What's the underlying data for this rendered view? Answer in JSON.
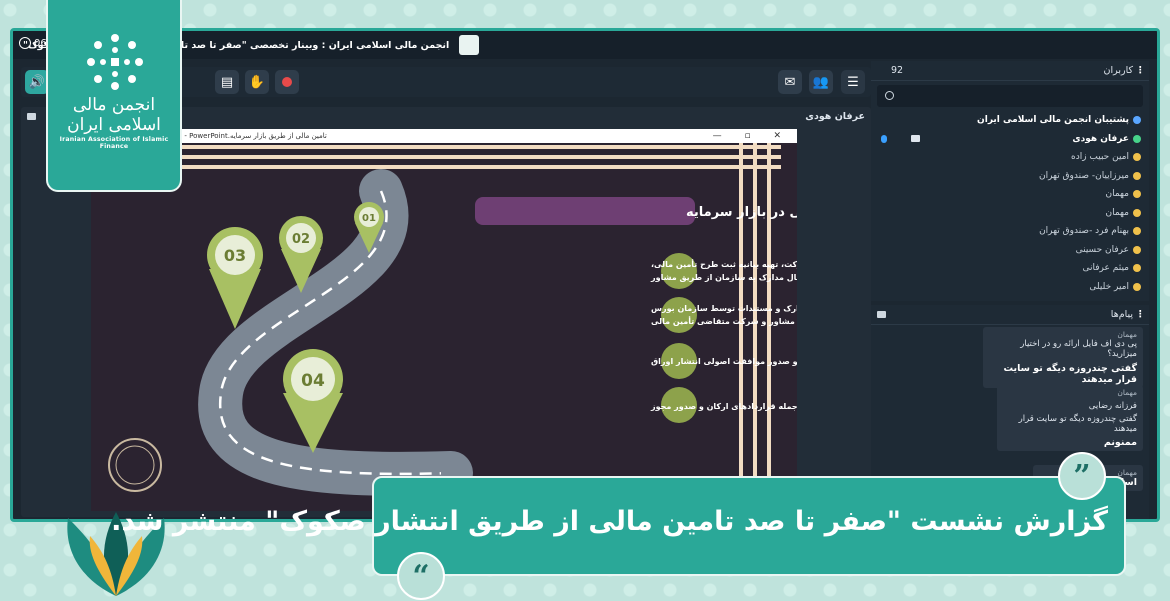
{
  "window": {
    "title": "انجمن مالی اسلامی ایران : وبینار تخصصی \"صفر تا صد تامین مالی از طریق انتشار صکوک\"",
    "clock": "06"
  },
  "stage": {
    "presenter": "عرفان هودی",
    "ppt_title": "ppt [Compatibility Mode] - PowerPoint.تامین مالی از طریق بازار سرمایه",
    "ppt_controls": "—  ▫  ✕"
  },
  "slide": {
    "heading": "مسیر تأمین مالی در بازار سرمایه",
    "steps": [
      {
        "num": "01",
        "lines": [
          "بررسی طرح توسط شرکت، تهیه بیانیه ثبت طرح تأمین مالی،",
          "دریافت نظر حسابرس و ارسال مدارک به سازمان از طریق مشاور"
        ]
      },
      {
        "num": "02",
        "lines": [
          "بررسی مدارک و مستندات توسط سازمان بورس",
          "و رفع نواقص توسط مشاور و شرکت متقاضی تأمین مالی"
        ]
      },
      {
        "num": "03",
        "lines": [
          "بررسی توسط سازمان و صدور موافقت اصولی انتشار اوراق"
        ]
      },
      {
        "num": "04",
        "lines": [
          "تکمیل مدارک از جمله قراردادهای ارکان و صدور مجوز"
        ]
      }
    ],
    "colors": {
      "bg": "#2b2330",
      "pill": "#6e3f73",
      "circle": "#8da24b",
      "pin": "#a8c063"
    }
  },
  "users_panel": {
    "title": "کاربران",
    "count": "92",
    "users": [
      {
        "name": "پشتیبان انجمن مالی اسلامی ایران",
        "bold": true,
        "icon": "blue"
      },
      {
        "name": "عرفان هودی",
        "bold": true,
        "icon": "green",
        "mic": true
      },
      {
        "name": "امین حبیب زاده",
        "icon": "yellow"
      },
      {
        "name": "میرزاییان- صندوق تهران",
        "icon": "yellow"
      },
      {
        "name": "مهمان",
        "icon": "yellow"
      },
      {
        "name": "مهمان",
        "icon": "yellow"
      },
      {
        "name": "بهنام فرد -صندوق تهران",
        "icon": "yellow"
      },
      {
        "name": "عرفان حسینی",
        "icon": "yellow"
      },
      {
        "name": "میثم عرفانی",
        "icon": "yellow"
      },
      {
        "name": "امیر خلیلی",
        "icon": "yellow"
      }
    ]
  },
  "messages_panel": {
    "title": "پیام‌ها",
    "msgs": [
      {
        "who": "مهمان",
        "text": "پی دی اف فایل ارائه رو در اختیار میزارید؟",
        "bold": "گفتی چندروزه دیگه تو سایت قرار میدهند"
      },
      {
        "who": "مهمان",
        "text": "فرزانه رضایی",
        "text2": "گفتی چندروزه دیگه تو سایت قرار میدهند",
        "bold": "ممنونم"
      },
      {
        "who": "مهمان",
        "bold": "اسا"
      }
    ]
  },
  "logo": {
    "fa": "انجمن مالی اسلامی ایران",
    "en": "Iranian Association of Islamic Finance"
  },
  "banner": {
    "text": "گزارش نشست \"صفر تا صد تامین مالی از طریق انتشار صکوک\" منتشر شد."
  },
  "quotes": {
    "open": "”",
    "close": "“"
  }
}
